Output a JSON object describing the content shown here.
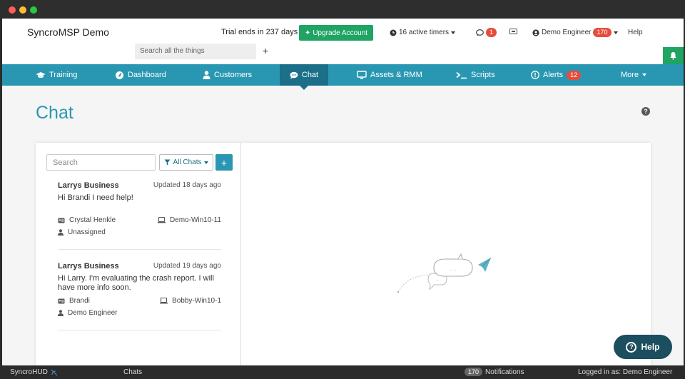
{
  "app": {
    "brand": "SyncroMSP Demo",
    "trial_text": "Trial ends in 237 days",
    "upgrade_label": "Upgrade Account"
  },
  "header": {
    "timers_label": "16 active timers",
    "messages_count": "1",
    "user_name": "Demo Engineer",
    "user_badge": "170",
    "help_label": "Help",
    "search_placeholder": "Search all the things",
    "plus_label": "+"
  },
  "nav": {
    "training": "Training",
    "dashboard": "Dashboard",
    "customers": "Customers",
    "chat": "Chat",
    "assets": "Assets & RMM",
    "scripts": "Scripts",
    "alerts": "Alerts",
    "alerts_count": "12",
    "more": "More"
  },
  "page": {
    "title": "Chat",
    "help_icon": "question-circle-icon"
  },
  "chat_list": {
    "search_placeholder": "Search",
    "filter_label": "All Chats",
    "add_label": "+",
    "items": [
      {
        "business": "Larrys Business",
        "updated": "Updated 18 days ago",
        "message": "Hi Brandi I need help!",
        "contact": "Crystal Henkle",
        "device": "Demo-Win10-11",
        "assignee": "Unassigned"
      },
      {
        "business": "Larrys Business",
        "updated": "Updated 19 days ago",
        "message": "Hi Larry. I'm evaluating the crash report. I will have more info soon.",
        "contact": "Brandi",
        "device": "Bobby-Win10-1",
        "assignee": "Demo Engineer"
      }
    ]
  },
  "help_fab": {
    "label": "Help"
  },
  "statusbar": {
    "hud_label": "SyncroHUD",
    "chats_label": "Chats",
    "notifications_count": "170",
    "notifications_label": "Notifications",
    "logged_in": "Logged in as: Demo Engineer"
  },
  "colors": {
    "teal": "#2a97b2",
    "teal_dark": "#1b6f88",
    "green": "#1fa463",
    "red": "#e74c3c"
  }
}
